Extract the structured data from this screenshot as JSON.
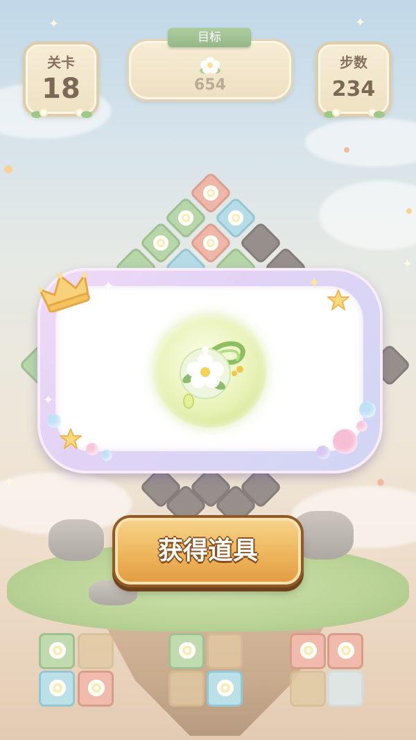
{
  "hud": {
    "level_label": "关卡",
    "level_value": "18",
    "target_label": "目标",
    "target_value": "654",
    "steps_label": "步数",
    "steps_value": "234"
  },
  "reward_popup": {
    "item_icon": "flower-charm-icon",
    "button_label": "获得道具"
  },
  "tray": {
    "slots": [
      {
        "color": "green",
        "has_flower": true
      },
      {
        "color": "empty",
        "has_flower": false
      },
      {
        "color": "blue",
        "has_flower": true
      },
      {
        "color": "red",
        "has_flower": true
      },
      {
        "color": "green",
        "has_flower": true
      },
      {
        "color": "empty",
        "has_flower": false
      },
      {
        "color": "empty",
        "has_flower": false
      },
      {
        "color": "blue",
        "has_flower": true
      },
      {
        "color": "red",
        "has_flower": true
      },
      {
        "color": "red",
        "has_flower": true
      },
      {
        "color": "empty",
        "has_flower": false
      },
      {
        "color": "empty-blue",
        "has_flower": false
      }
    ]
  },
  "colors": {
    "button_orange": "#eeb95f",
    "hud_bg": "#f3e6c6",
    "ribbon_green": "#7aa867",
    "popup_lavender": "#e2d3f6"
  }
}
